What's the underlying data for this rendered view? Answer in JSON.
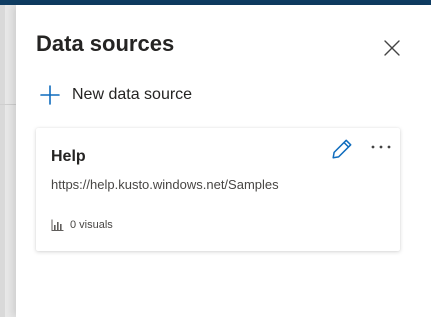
{
  "panel": {
    "title": "Data sources",
    "close_icon": "close-icon",
    "new_source_label": "New data source",
    "new_source_icon": "plus-icon"
  },
  "data_sources": [
    {
      "name": "Help",
      "url": "https://help.kusto.windows.net/Samples",
      "visuals": "0 visuals",
      "visuals_icon": "bar-chart-icon",
      "edit_icon": "pencil-icon",
      "more_icon": "more-icon"
    }
  ],
  "colors": {
    "accent": "#0f6cbd",
    "top_bar": "#0f3d63",
    "text": "#252423",
    "secondary_text": "#484644"
  }
}
